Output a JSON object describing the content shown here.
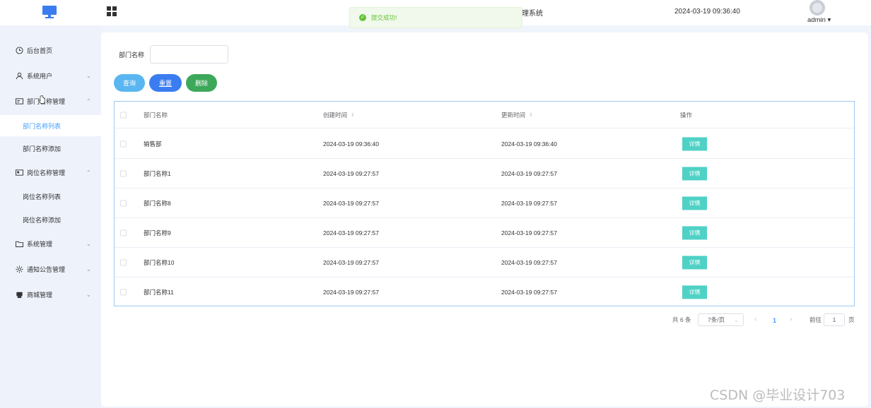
{
  "header": {
    "title_fragment": "理系统",
    "datetime": "2024-03-19 09:36:40",
    "user": "admin ▾",
    "brand_color": "#3b7df0"
  },
  "toast": {
    "message": "提交成功!",
    "type": "success",
    "icon": "check-circle-icon"
  },
  "sidebar": {
    "items": [
      {
        "label": "后台首页",
        "icon": "clock-icon"
      },
      {
        "label": "系统用户",
        "icon": "user-icon",
        "arrow": "⌄"
      },
      {
        "label": "部门名称管理",
        "icon": "id-card-icon",
        "arrow": "⌃",
        "expanded": true
      },
      {
        "label": "岗位名称管理",
        "icon": "postcard-icon",
        "arrow": "⌃",
        "expanded": true
      },
      {
        "label": "系统管理",
        "icon": "folder-icon",
        "arrow": "⌄"
      },
      {
        "label": "通知公告管理",
        "icon": "sun-icon",
        "arrow": "⌄"
      },
      {
        "label": "商城管理",
        "icon": "printer-icon",
        "arrow": "⌄"
      }
    ],
    "dept_sub": [
      "部门名称列表",
      "部门名称添加"
    ],
    "post_sub": [
      "岗位名称列表",
      "岗位名称添加"
    ],
    "active_sub": "部门名称列表"
  },
  "filter": {
    "label": "部门名称",
    "value": "",
    "placeholder": ""
  },
  "buttons": {
    "query": "查询",
    "reset": "重置",
    "delete": "删除"
  },
  "table": {
    "columns": [
      "部门名称",
      "创建时间",
      "更新时间",
      "操作"
    ],
    "sort_glyph": "⇕",
    "action_label": "详情",
    "rows": [
      {
        "name": "销售部",
        "created": "2024-03-19 09:36:40",
        "updated": "2024-03-19 09:36:40"
      },
      {
        "name": "部门名称1",
        "created": "2024-03-19 09:27:57",
        "updated": "2024-03-19 09:27:57"
      },
      {
        "name": "部门名称8",
        "created": "2024-03-19 09:27:57",
        "updated": "2024-03-19 09:27:57"
      },
      {
        "name": "部门名称9",
        "created": "2024-03-19 09:27:57",
        "updated": "2024-03-19 09:27:57"
      },
      {
        "name": "部门名称10",
        "created": "2024-03-19 09:27:57",
        "updated": "2024-03-19 09:27:57"
      },
      {
        "name": "部门名称11",
        "created": "2024-03-19 09:27:57",
        "updated": "2024-03-19 09:27:57"
      }
    ]
  },
  "pagination": {
    "total": "共 6 条",
    "page_size": "7条/页",
    "current_page": "1",
    "goto_label": "前往",
    "goto_value": "1",
    "page_suffix": "页"
  },
  "watermark": "CSDN @毕业设计703"
}
